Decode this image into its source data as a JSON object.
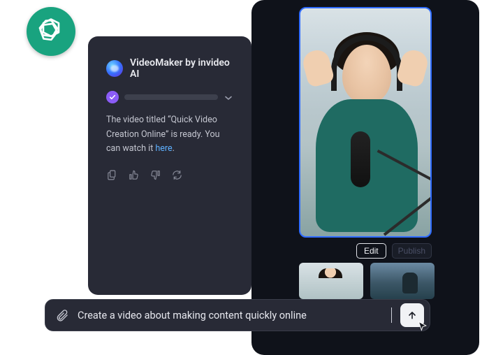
{
  "badge": {
    "icon_name": "openai-logo"
  },
  "chat": {
    "title": "VideoMaker by invideo AI",
    "message_prefix": "The video titled “Quick Video Creation Online” is ready. You can watch it ",
    "message_link_text": "here",
    "message_suffix": ".",
    "actions": {
      "copy": "copy-icon",
      "thumbs_up": "thumbs-up-icon",
      "thumbs_down": "thumbs-down-icon",
      "refresh": "refresh-icon"
    }
  },
  "preview": {
    "edit_label": "Edit",
    "publish_label": "Publish"
  },
  "prompt": {
    "text": "Create a video about making content quickly online",
    "attach_icon": "paperclip-icon",
    "send_icon": "upload-arrow-icon"
  },
  "colors": {
    "accent_purple": "#8b5cf6",
    "brand_green": "#19a37f",
    "link": "#5eb0ff"
  }
}
